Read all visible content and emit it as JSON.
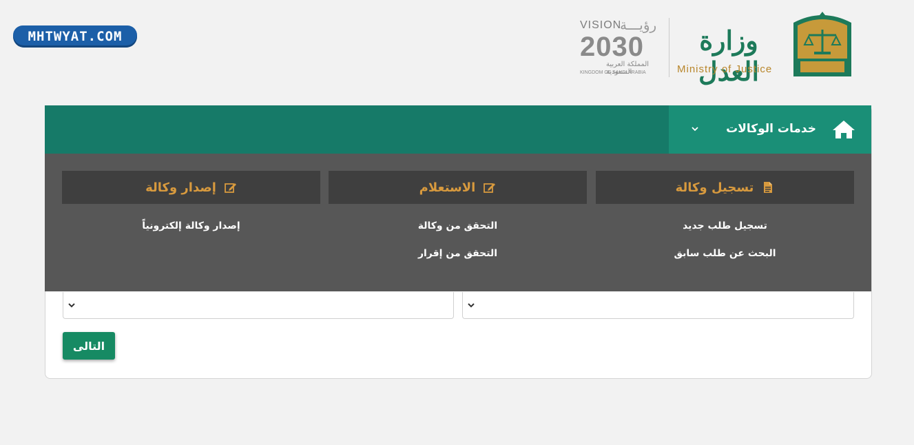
{
  "watermark": "MHTWYAT.COM",
  "vision": {
    "label": "VISION",
    "arabic_title": "رؤيـــة",
    "year": "2030",
    "country_ar": "المملكة العربية السعودية",
    "country_en": "KINGDOM OF SAUDI ARABIA"
  },
  "ministry": {
    "name_ar": "وزارة العدل",
    "name_en": "Ministry of Justice"
  },
  "navbar": {
    "menu_label": "خدمات الوكالات",
    "home_icon": "home-icon",
    "chevron_icon": "chevron-down-icon"
  },
  "menu": {
    "columns": [
      {
        "heading": "تسجيل وكالة",
        "icon": "document-icon",
        "links": [
          "تسجيل طلب جديد",
          "البحث عن طلب سابق"
        ]
      },
      {
        "heading": "الاستعلام",
        "icon": "edit-icon",
        "links": [
          "التحقق من وكالة",
          "التحقق من إقرار"
        ]
      },
      {
        "heading": "إصدار وكالة",
        "icon": "edit-icon",
        "links": [
          "إصدار وكالة إلكترونياً"
        ]
      }
    ]
  },
  "form": {
    "next_button": "التالى"
  },
  "colors": {
    "nav": "#167a68",
    "nav_active": "#1a8f77",
    "dropdown": "#575757",
    "heading_bg": "#3f3f3f",
    "accent": "#d89a3e",
    "button": "#168a63"
  }
}
